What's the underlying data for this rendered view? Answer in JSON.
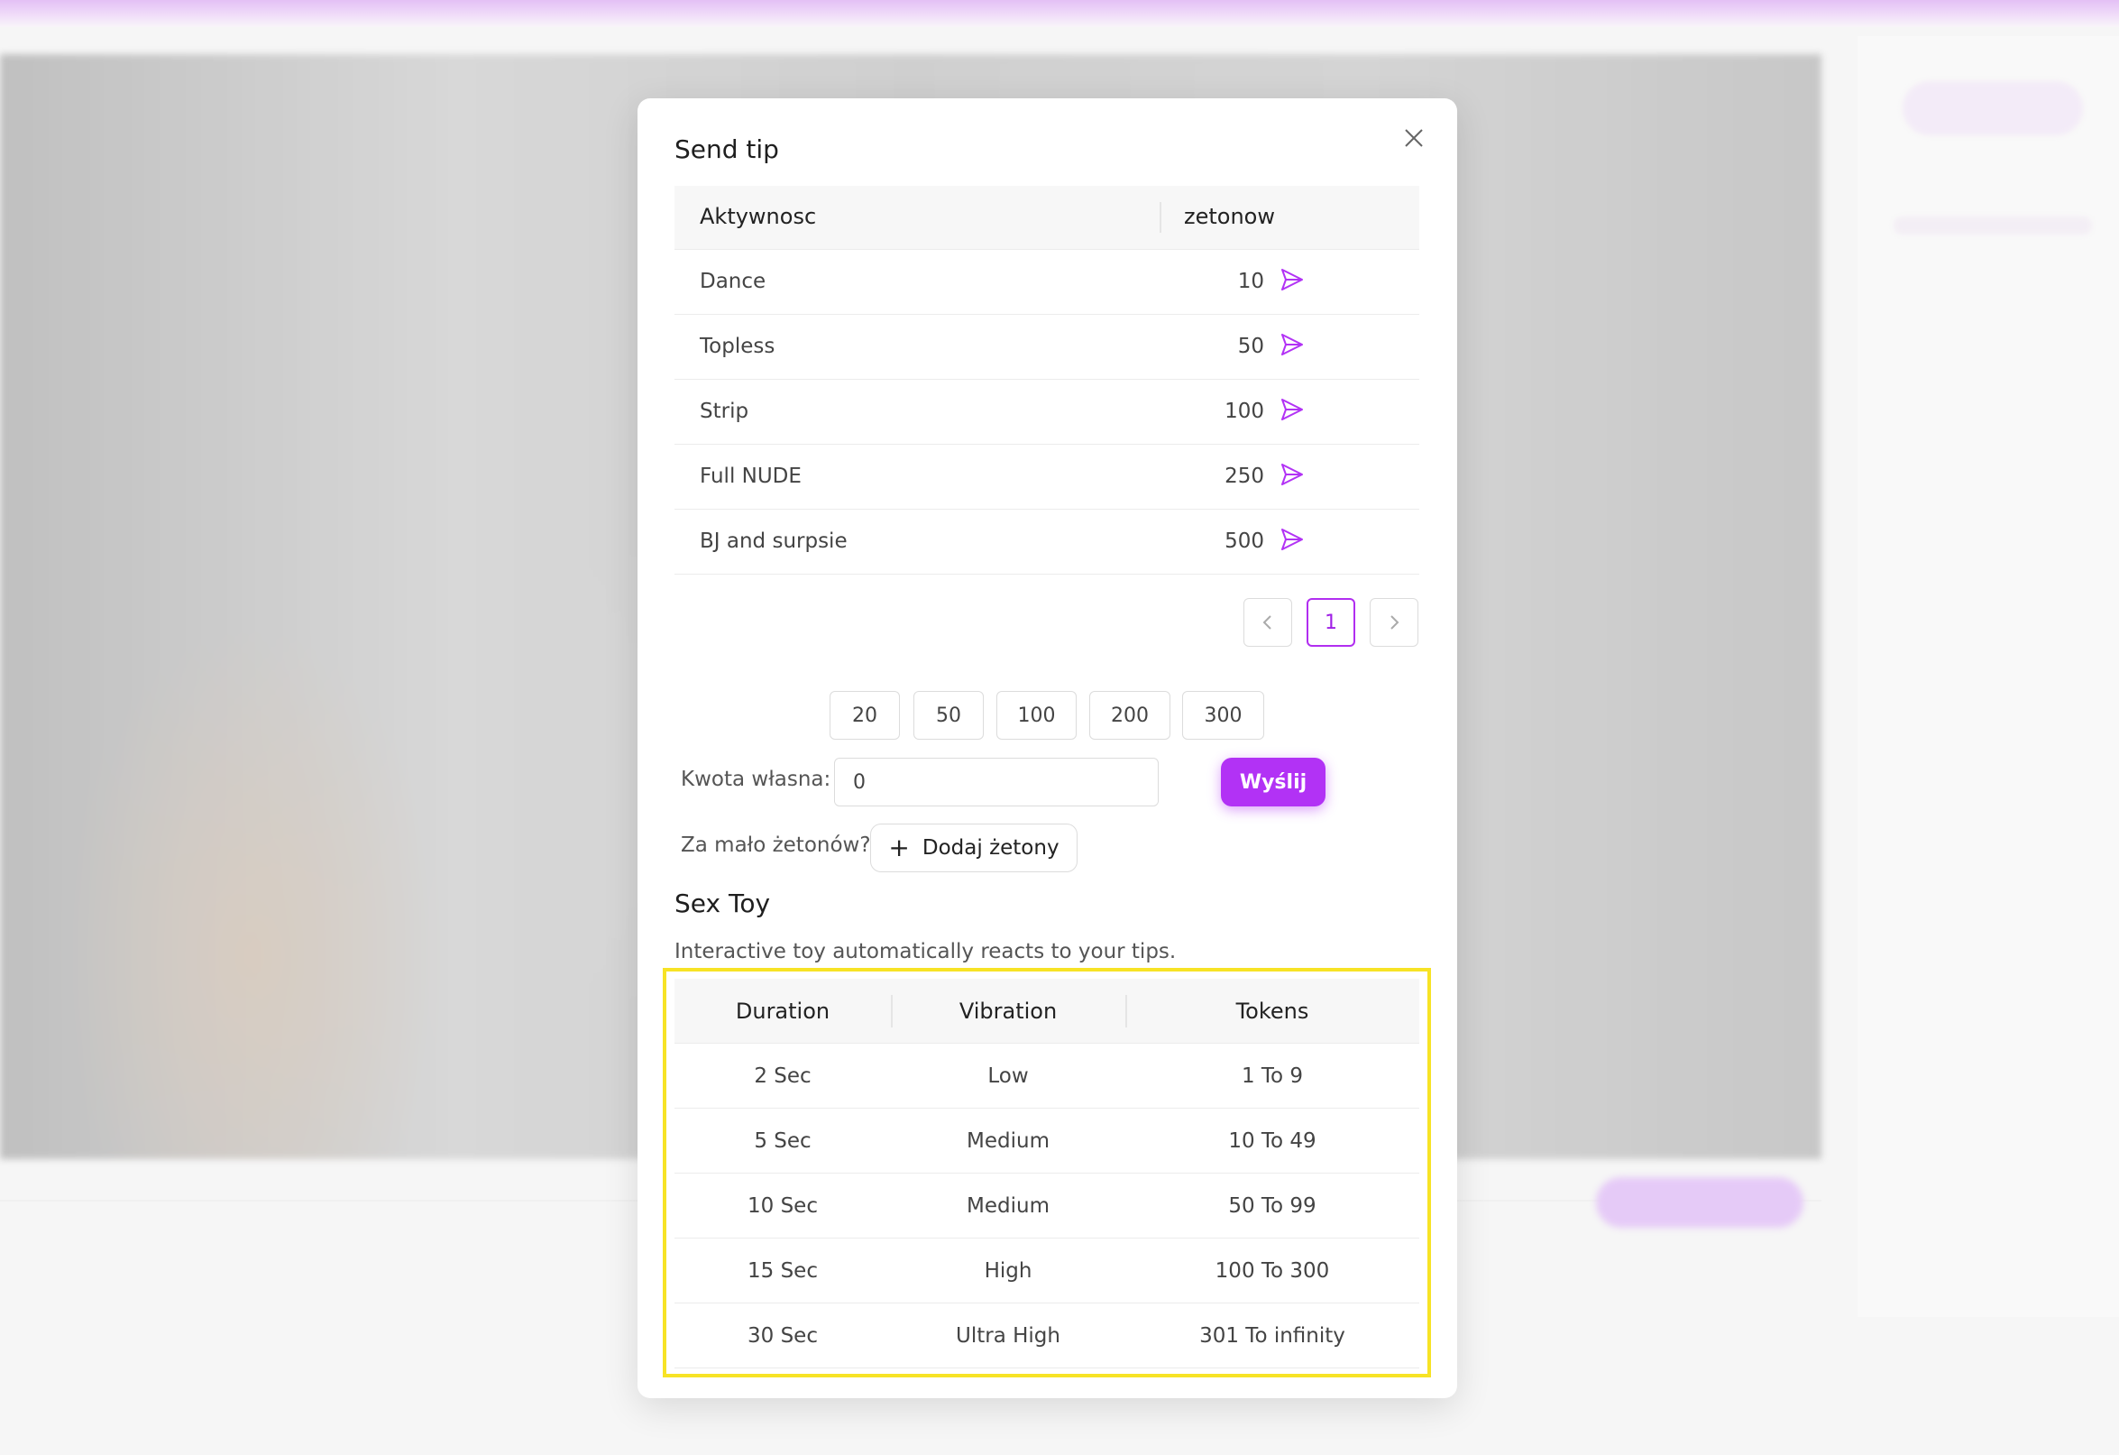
{
  "modal": {
    "title": "Send tip",
    "close_icon": "close-icon"
  },
  "tip_table": {
    "headers": [
      "Aktywnosc",
      "zetonow"
    ],
    "rows": [
      {
        "name": "Dance",
        "price": "10"
      },
      {
        "name": "Topless",
        "price": "50"
      },
      {
        "name": "Strip",
        "price": "100"
      },
      {
        "name": "Full NUDE",
        "price": "250"
      },
      {
        "name": "BJ and surpsie",
        "price": "500"
      }
    ],
    "send_icon": "send-icon"
  },
  "pagination": {
    "current": "1"
  },
  "quick_amounts": [
    "20",
    "50",
    "100",
    "200",
    "300"
  ],
  "custom_amount": {
    "label": "Kwota własna:",
    "value": "0",
    "send_label": "Wyślij"
  },
  "add_tokens": {
    "label": "Za mało żetonów?",
    "button_label": "Dodaj żetony"
  },
  "sex_toy": {
    "title": "Sex Toy",
    "subtitle": "Interactive toy automatically reacts to your tips.",
    "headers": [
      "Duration",
      "Vibration",
      "Tokens"
    ],
    "rows": [
      {
        "duration": "2 Sec",
        "vibration": "Low",
        "tokens": "1 To 9"
      },
      {
        "duration": "5 Sec",
        "vibration": "Medium",
        "tokens": "10 To 49"
      },
      {
        "duration": "10 Sec",
        "vibration": "Medium",
        "tokens": "50 To 99"
      },
      {
        "duration": "15 Sec",
        "vibration": "High",
        "tokens": "100 To 300"
      },
      {
        "duration": "30 Sec",
        "vibration": "Ultra High",
        "tokens": "301 To infinity"
      }
    ]
  },
  "colors": {
    "accent": "#b232f5",
    "highlight": "#f7e325"
  }
}
